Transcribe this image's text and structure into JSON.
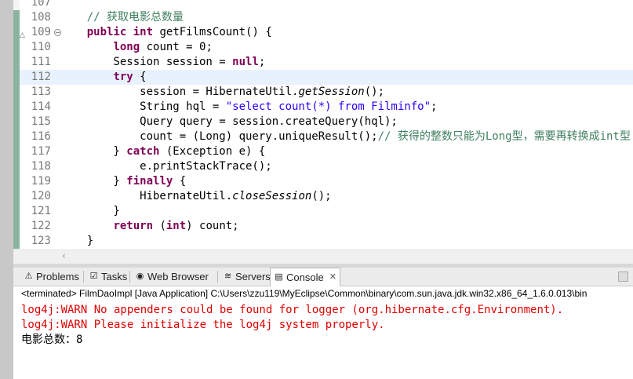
{
  "editor": {
    "lines": [
      {
        "n": "107",
        "tokens": []
      },
      {
        "n": "108",
        "tokens": [
          {
            "t": "    "
          },
          {
            "t": "// 获取电影总数量",
            "c": "cm"
          }
        ]
      },
      {
        "n": "109",
        "tokens": [
          {
            "t": "    "
          },
          {
            "t": "public",
            "c": "kw"
          },
          {
            "t": " "
          },
          {
            "t": "int",
            "c": "kw"
          },
          {
            "t": " getFilmsCount() {"
          }
        ]
      },
      {
        "n": "110",
        "tokens": [
          {
            "t": "        "
          },
          {
            "t": "long",
            "c": "kw"
          },
          {
            "t": " count = 0;"
          }
        ]
      },
      {
        "n": "111",
        "tokens": [
          {
            "t": "        Session session = "
          },
          {
            "t": "null",
            "c": "kw"
          },
          {
            "t": ";"
          }
        ]
      },
      {
        "n": "112",
        "tokens": [
          {
            "t": "        "
          },
          {
            "t": "try",
            "c": "kw"
          },
          {
            "t": " {"
          }
        ]
      },
      {
        "n": "113",
        "tokens": [
          {
            "t": "            session = HibernateUtil."
          },
          {
            "t": "getSession",
            "c": "it"
          },
          {
            "t": "();"
          }
        ]
      },
      {
        "n": "114",
        "tokens": [
          {
            "t": "            String hql = "
          },
          {
            "t": "\"select count(*) from Filminfo\"",
            "c": "str"
          },
          {
            "t": ";"
          }
        ]
      },
      {
        "n": "115",
        "tokens": [
          {
            "t": "            Query query = session.createQuery(hql);"
          }
        ]
      },
      {
        "n": "116",
        "tokens": [
          {
            "t": "            count = (Long) query.uniqueResult();"
          },
          {
            "t": "// 获得的整数只能为Long型，需要再转换成int型",
            "c": "cm"
          }
        ]
      },
      {
        "n": "117",
        "tokens": [
          {
            "t": "        } "
          },
          {
            "t": "catch",
            "c": "kw"
          },
          {
            "t": " (Exception e) {"
          }
        ]
      },
      {
        "n": "118",
        "tokens": [
          {
            "t": "            e.printStackTrace();"
          }
        ]
      },
      {
        "n": "119",
        "tokens": [
          {
            "t": "        } "
          },
          {
            "t": "finally",
            "c": "kw"
          },
          {
            "t": " {"
          }
        ]
      },
      {
        "n": "120",
        "tokens": [
          {
            "t": "            HibernateUtil."
          },
          {
            "t": "closeSession",
            "c": "it"
          },
          {
            "t": "();"
          }
        ]
      },
      {
        "n": "121",
        "tokens": [
          {
            "t": "        }"
          }
        ]
      },
      {
        "n": "122",
        "tokens": [
          {
            "t": "        "
          },
          {
            "t": "return",
            "c": "kw"
          },
          {
            "t": " ("
          },
          {
            "t": "int",
            "c": "kw"
          },
          {
            "t": ") count;"
          }
        ]
      },
      {
        "n": "123",
        "tokens": [
          {
            "t": "    }"
          }
        ]
      }
    ],
    "current_line": "112"
  },
  "views": {
    "tabs": [
      {
        "label": "Problems",
        "icon": "problems-icon",
        "glyph": "⚠"
      },
      {
        "label": "Tasks",
        "icon": "tasks-icon",
        "glyph": "☑"
      },
      {
        "label": "Web Browser",
        "icon": "globe-icon",
        "glyph": "◉"
      },
      {
        "label": "Servers",
        "icon": "servers-icon",
        "glyph": "≋"
      },
      {
        "label": "Console",
        "icon": "console-icon",
        "glyph": "▤",
        "active": true
      }
    ],
    "close_glyph": "✕"
  },
  "console": {
    "header": "<terminated> FilmDaoImpl [Java Application] C:\\Users\\zzu119\\MyEclipse\\Common\\binary\\com.sun.java.jdk.win32.x86_64_1.6.0.013\\bin",
    "output": [
      {
        "text": "log4j:WARN No appenders could be found for logger (org.hibernate.cfg.Environment).",
        "type": "err"
      },
      {
        "text": "log4j:WARN Please initialize the log4j system properly.",
        "type": "err"
      },
      {
        "text": "电影总数：8",
        "type": "normal"
      }
    ]
  },
  "colors": {
    "keyword": "#7f0055",
    "string": "#2a00ff",
    "comment": "#3f7f5f",
    "error": "#e00000"
  }
}
